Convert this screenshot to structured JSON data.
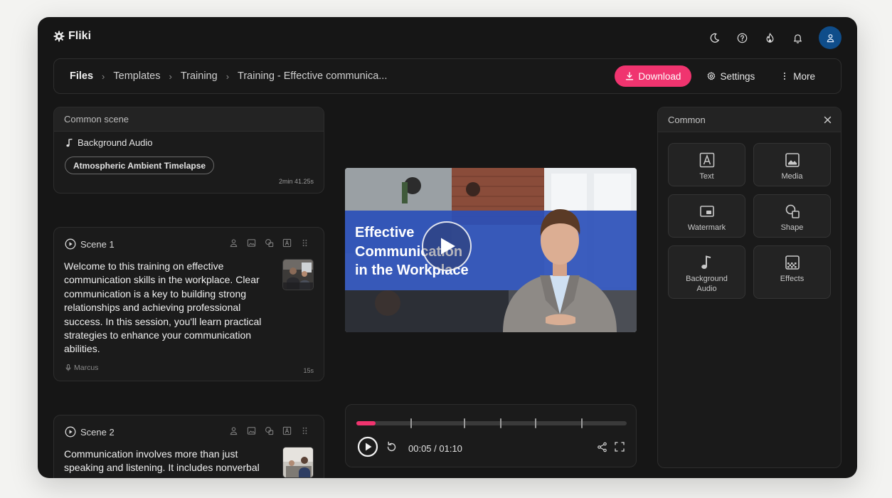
{
  "app": {
    "name": "Fliki"
  },
  "top_icons": [
    "moon-icon",
    "help-icon",
    "fire-icon",
    "bell-icon",
    "user-icon"
  ],
  "breadcrumb": {
    "items": [
      "Files",
      "Templates",
      "Training",
      "Training - Effective communica..."
    ]
  },
  "actions": {
    "download": "Download",
    "settings": "Settings",
    "more": "More"
  },
  "common_scene": {
    "header": "Common scene",
    "audio_label": "Background Audio",
    "audio_track": "Atmospheric Ambient Timelapse",
    "duration": "2min 41.25s"
  },
  "scenes": [
    {
      "title": "Scene 1",
      "text": "Welcome to this training on effective communication skills in the workplace. Clear communication is a key to building strong relationships and achieving professional success. In this session, you'll learn practical strategies to enhance your communication abilities.",
      "voice": "Marcus",
      "duration": "15s"
    },
    {
      "title": "Scene 2",
      "text": "Communication involves more than just speaking and listening. It includes nonverbal"
    }
  ],
  "video": {
    "title_line1": "Effective",
    "title_line2": "Communication",
    "title_line3": "in the Workplace"
  },
  "player": {
    "time": "00:05 / 01:10",
    "progress": 0.07
  },
  "panel": {
    "header": "Common",
    "tiles": [
      "Text",
      "Media",
      "Watermark",
      "Shape",
      "Background Audio",
      "Effects"
    ]
  },
  "colors": {
    "accent": "#f0346f",
    "avatar": "#0f4d8a",
    "background": "#161616"
  }
}
